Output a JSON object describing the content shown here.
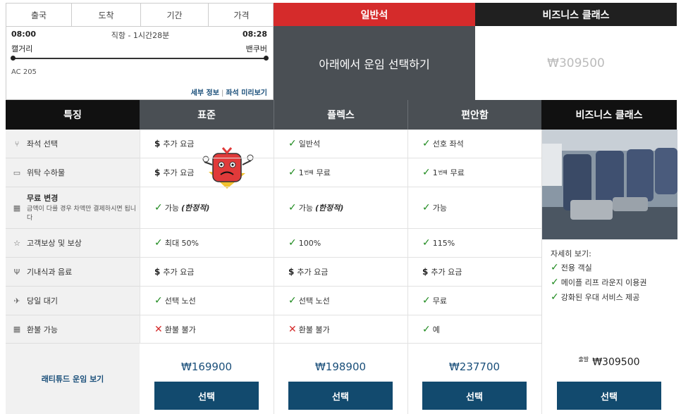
{
  "flight": {
    "col_depart": "출국",
    "col_arrive": "도착",
    "col_duration": "기간",
    "col_price": "가격",
    "dep_time": "08:00",
    "arr_time": "08:28",
    "route_info": "직항 - 1시간28분",
    "dep_city": "캘거리",
    "arr_city": "밴쿠버",
    "flight_no": "AC 205",
    "details_link": "세부 정보",
    "link_sep": "|",
    "seat_preview_link": "좌석 미리보기"
  },
  "fare_header": {
    "economy": "일반석",
    "business": "비즈니스 클래스",
    "select_below": "아래에서 운임 선택하기",
    "business_price": "₩309500"
  },
  "table_header": {
    "feature": "특징",
    "standard": "표준",
    "flex": "플렉스",
    "latitude": "편안함",
    "business": "비즈니스 클래스"
  },
  "rows": [
    {
      "icon": "seat-icon",
      "glyph": "⑂",
      "label": "좌석 선택",
      "std": {
        "mark": "$",
        "text": "추가 요금"
      },
      "flex": {
        "mark": "✓",
        "text": "일반석"
      },
      "lat": {
        "mark": "✓",
        "text": "선호 좌석"
      }
    },
    {
      "icon": "bag-icon",
      "glyph": "▭",
      "label": "위탁 수하물",
      "std": {
        "mark": "$",
        "text": "추가 요금"
      },
      "flex": {
        "mark": "✓",
        "pre": "1",
        "sup": "번째",
        "text": "무료"
      },
      "lat": {
        "mark": "✓",
        "pre": "1",
        "sup": "번째",
        "text": "무료"
      }
    },
    {
      "icon": "calendar-icon",
      "glyph": "▦",
      "label": "무료 변경",
      "sub": "금액이 다를 경우 차액만 결제하시면 됩니다",
      "std": {
        "mark": "✓",
        "text": "가능",
        "em": "(한정적)"
      },
      "flex": {
        "mark": "✓",
        "text": "가능",
        "em": "(한정적)"
      },
      "lat": {
        "mark": "✓",
        "text": "가능"
      }
    },
    {
      "icon": "star-icon",
      "glyph": "☆",
      "label": "고객보상 및 보상",
      "std": {
        "mark": "✓",
        "text": "최대 50%"
      },
      "flex": {
        "mark": "✓",
        "text": "100%"
      },
      "lat": {
        "mark": "✓",
        "text": "115%"
      }
    },
    {
      "icon": "cutlery-icon",
      "glyph": "Ψ",
      "label": "기내식과 음료",
      "std": {
        "mark": "$",
        "text": "추가 요금"
      },
      "flex": {
        "mark": "$",
        "text": "추가 요금"
      },
      "lat": {
        "mark": "$",
        "text": "추가 요금"
      }
    },
    {
      "icon": "standby-icon",
      "glyph": "✈",
      "label": "당일 대기",
      "std": {
        "mark": "✓",
        "text": "선택 노선"
      },
      "flex": {
        "mark": "✓",
        "text": "선택 노선"
      },
      "lat": {
        "mark": "✓",
        "text": "무료"
      }
    },
    {
      "icon": "refund-icon",
      "glyph": "▦",
      "label": "환불 가능",
      "std": {
        "mark": "✕",
        "text": "환불 불가"
      },
      "flex": {
        "mark": "✕",
        "text": "환불 불가"
      },
      "lat": {
        "mark": "✓",
        "text": "예"
      }
    }
  ],
  "business_panel": {
    "more": "자세히 보기:",
    "items": [
      "전용 객실",
      "메이플 리프 라운지 이용권",
      "강화된 우대 서비스 제공"
    ],
    "from": "출발",
    "price": "₩309500",
    "select": "선택"
  },
  "bottom": {
    "latitude_link": "래티튜드 운임 보기",
    "std_price": "₩169900",
    "flex_price": "₩198900",
    "lat_price": "₩237700",
    "select": "선택"
  },
  "colors": {
    "economy": "#d52b2b",
    "button": "#124a6e",
    "check": "#1e8a1e"
  }
}
